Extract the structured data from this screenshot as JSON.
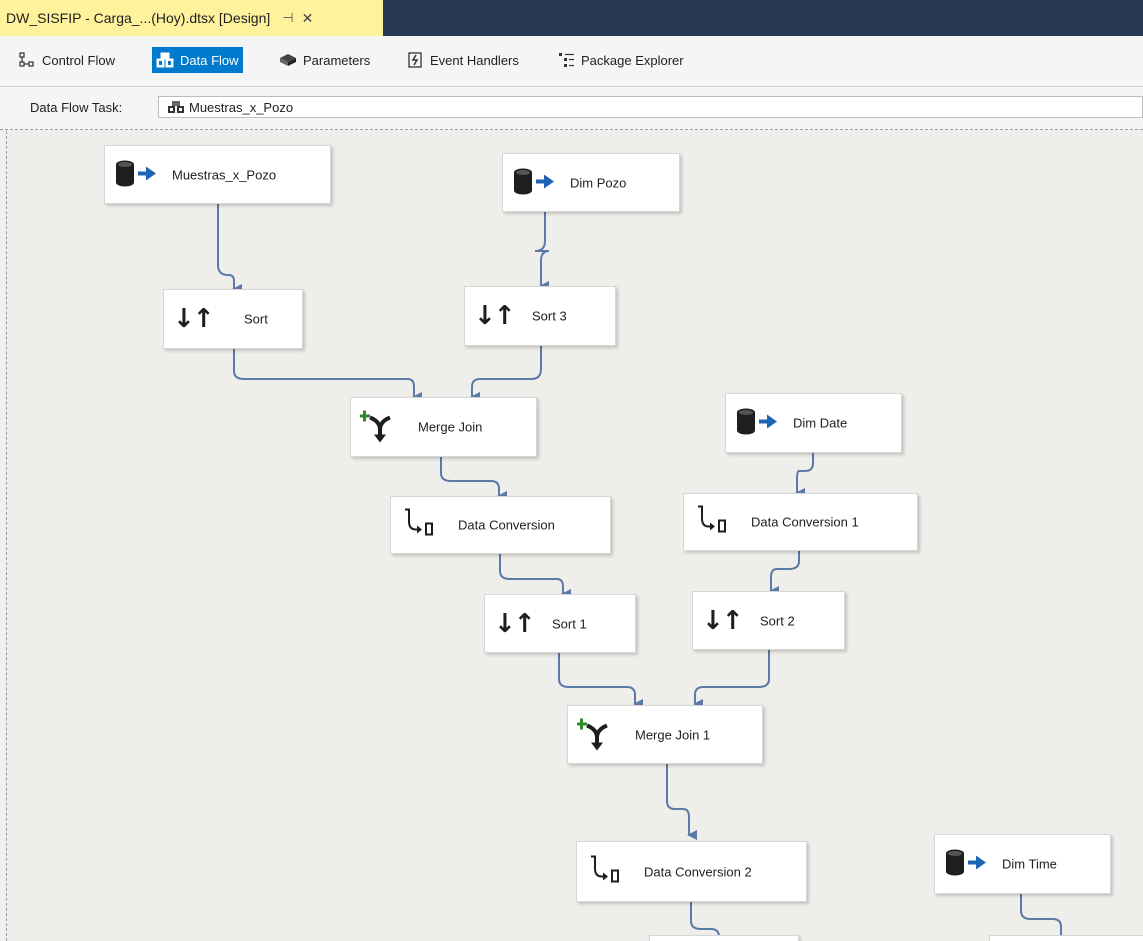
{
  "document_tab": {
    "title": "DW_SISFIP - Carga_...(Hoy).dtsx [Design]",
    "pin_glyph": "⊣",
    "close_glyph": "✕"
  },
  "designer_tabs": [
    {
      "label": "Control Flow",
      "icon": "control-flow-icon",
      "active": false
    },
    {
      "label": "Data Flow",
      "icon": "data-flow-icon",
      "active": true
    },
    {
      "label": "Parameters",
      "icon": "parameters-icon",
      "active": false
    },
    {
      "label": "Event Handlers",
      "icon": "event-handlers-icon",
      "active": false
    },
    {
      "label": "Package Explorer",
      "icon": "package-explorer-icon",
      "active": false
    }
  ],
  "task": {
    "label": "Data Flow Task:",
    "value": "Muestras_x_Pozo"
  },
  "components": {
    "muestras_x_pozo": {
      "label": "Muestras_x_Pozo",
      "icon": "source-icon"
    },
    "dim_pozo": {
      "label": "Dim Pozo",
      "icon": "source-icon"
    },
    "sort": {
      "label": "Sort",
      "icon": "sort-icon"
    },
    "sort_3": {
      "label": "Sort 3",
      "icon": "sort-icon"
    },
    "merge_join": {
      "label": "Merge Join",
      "icon": "merge-join-icon"
    },
    "dim_date": {
      "label": "Dim Date",
      "icon": "source-icon"
    },
    "data_conversion": {
      "label": "Data Conversion",
      "icon": "data-conversion-icon"
    },
    "data_conversion_1": {
      "label": "Data Conversion 1",
      "icon": "data-conversion-icon"
    },
    "sort_1": {
      "label": "Sort 1",
      "icon": "sort-icon"
    },
    "sort_2": {
      "label": "Sort 2",
      "icon": "sort-icon"
    },
    "merge_join_1": {
      "label": "Merge Join 1",
      "icon": "merge-join-icon"
    },
    "data_conversion_2": {
      "label": "Data Conversion 2",
      "icon": "data-conversion-icon"
    },
    "dim_time": {
      "label": "Dim Time",
      "icon": "source-icon"
    }
  },
  "colors": {
    "tab_bar": "#293955",
    "active_doc_tab": "#fff29d",
    "active_designer_tab": "#007acc",
    "canvas": "#efeeea",
    "connector": "#5b7aa8",
    "source_arrow": "#1e64b4",
    "merge_plus": "#2e8b2e"
  }
}
